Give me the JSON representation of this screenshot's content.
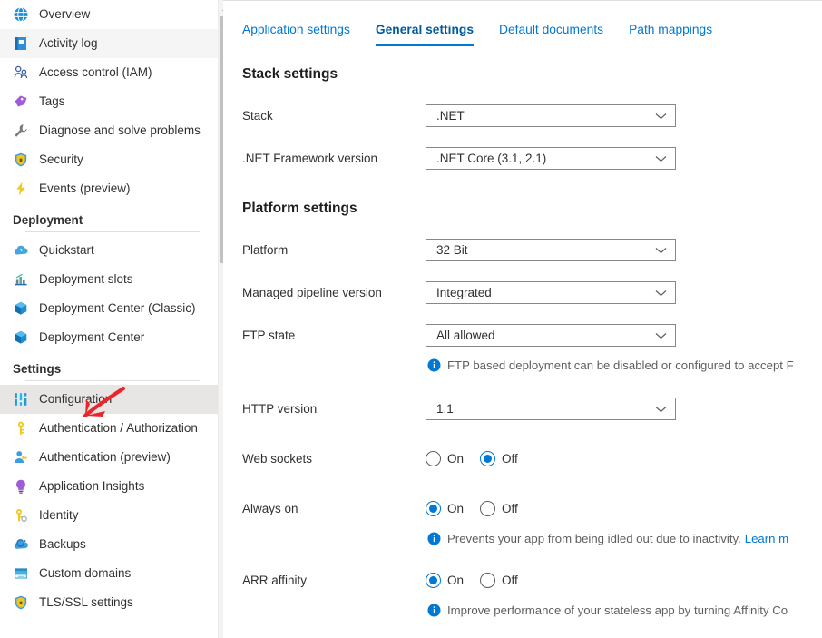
{
  "sidebar": {
    "items": [
      {
        "label": "Overview",
        "icon": "globe-icon",
        "state": "normal"
      },
      {
        "label": "Activity log",
        "icon": "activity-log-icon",
        "state": "hover"
      },
      {
        "label": "Access control (IAM)",
        "icon": "access-control-icon",
        "state": "normal"
      },
      {
        "label": "Tags",
        "icon": "tag-icon",
        "state": "normal"
      },
      {
        "label": "Diagnose and solve problems",
        "icon": "wrench-icon",
        "state": "normal"
      },
      {
        "label": "Security",
        "icon": "shield-icon",
        "state": "normal"
      },
      {
        "label": "Events (preview)",
        "icon": "lightning-icon",
        "state": "normal"
      }
    ],
    "groups": [
      {
        "title": "Deployment",
        "items": [
          {
            "label": "Quickstart",
            "icon": "cloud-icon",
            "state": "normal"
          },
          {
            "label": "Deployment slots",
            "icon": "chart-icon",
            "state": "normal"
          },
          {
            "label": "Deployment Center (Classic)",
            "icon": "cube-icon",
            "state": "normal"
          },
          {
            "label": "Deployment Center",
            "icon": "cube-icon",
            "state": "normal"
          }
        ]
      },
      {
        "title": "Settings",
        "items": [
          {
            "label": "Configuration",
            "icon": "sliders-icon",
            "state": "selected"
          },
          {
            "label": "Authentication / Authorization",
            "icon": "key-icon",
            "state": "normal"
          },
          {
            "label": "Authentication (preview)",
            "icon": "user-key-icon",
            "state": "normal"
          },
          {
            "label": "Application Insights",
            "icon": "bulb-icon",
            "state": "normal"
          },
          {
            "label": "Identity",
            "icon": "identity-key-icon",
            "state": "normal"
          },
          {
            "label": "Backups",
            "icon": "backup-cloud-icon",
            "state": "normal"
          },
          {
            "label": "Custom domains",
            "icon": "domain-icon",
            "state": "normal"
          },
          {
            "label": "TLS/SSL settings",
            "icon": "shield-icon",
            "state": "normal"
          }
        ]
      }
    ]
  },
  "scrollbar": {
    "up_arrow_icon": "scroll-up-arrow-icon"
  },
  "main": {
    "tabs": [
      {
        "label": "Application settings",
        "active": false
      },
      {
        "label": "General settings",
        "active": true
      },
      {
        "label": "Default documents",
        "active": false
      },
      {
        "label": "Path mappings",
        "active": false
      }
    ],
    "stack_section": {
      "title": "Stack settings",
      "rows": [
        {
          "label": "Stack",
          "value": ".NET"
        },
        {
          "label": ".NET Framework version",
          "value": ".NET Core (3.1, 2.1)"
        }
      ]
    },
    "platform_section": {
      "title": "Platform settings",
      "dropdowns": [
        {
          "label": "Platform",
          "value": "32 Bit"
        },
        {
          "label": "Managed pipeline version",
          "value": "Integrated"
        },
        {
          "label": "FTP state",
          "value": "All allowed"
        }
      ],
      "ftp_info": "FTP based deployment can be disabled or configured to accept F",
      "http_version": {
        "label": "HTTP version",
        "value": "1.1"
      },
      "web_sockets": {
        "label": "Web sockets",
        "on_label": "On",
        "off_label": "Off",
        "selected": "Off"
      },
      "always_on": {
        "label": "Always on",
        "on_label": "On",
        "off_label": "Off",
        "selected": "On",
        "info": "Prevents your app from being idled out due to inactivity.",
        "info_link": "Learn m"
      },
      "arr_affinity": {
        "label": "ARR affinity",
        "on_label": "On",
        "off_label": "Off",
        "selected": "On",
        "info": "Improve performance of your stateless app by turning Affinity Co"
      }
    }
  },
  "annotation": {
    "type": "red-arrow",
    "points_to": "Configuration",
    "color": "#e8262b"
  },
  "colors": {
    "accent": "#0078d4",
    "tab_active": "#005a9e",
    "selected_nav_bg": "#e8e6e4",
    "hover_nav_bg": "#f5f5f5",
    "border": "#8a8886",
    "info_text": "#605e5c"
  }
}
